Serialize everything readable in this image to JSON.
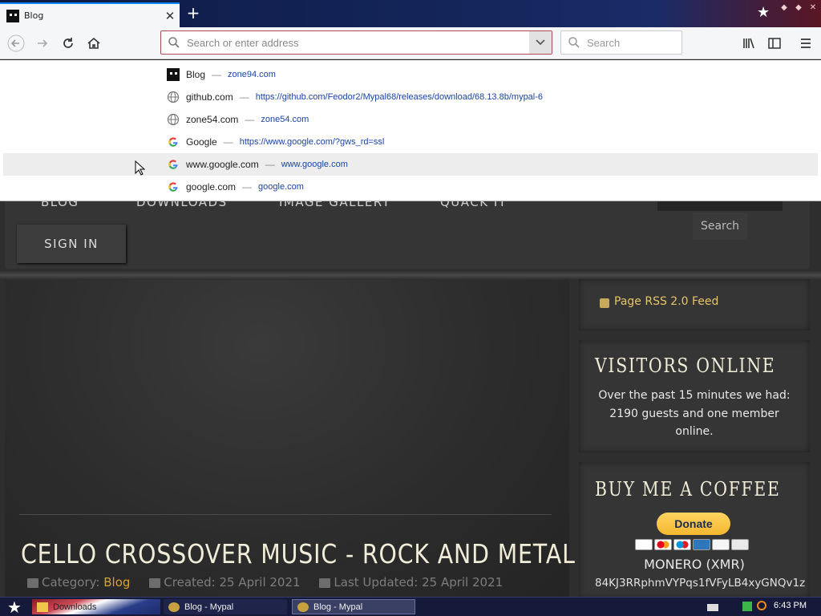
{
  "browser": {
    "tab": {
      "title": "Blog",
      "close_glyph": "✕"
    },
    "new_tab_glyph": "+",
    "url_bar": {
      "value": "",
      "placeholder": "Search or enter address"
    },
    "search_bar": {
      "placeholder": "Search"
    }
  },
  "suggestions": [
    {
      "icon": "site-favicon",
      "title": "Blog",
      "url": "zone94.com"
    },
    {
      "icon": "globe-icon",
      "title": "github.com",
      "url": "https://github.com/Feodor2/Mypal68/releases/download/68.13.8b/mypal-6"
    },
    {
      "icon": "globe-icon",
      "title": "zone54.com",
      "url": "zone54.com"
    },
    {
      "icon": "google-icon",
      "title": "Google",
      "url": "https://www.google.com/?gws_rd=ssl"
    },
    {
      "icon": "google-icon",
      "title": "www.google.com",
      "url": "www.google.com"
    },
    {
      "icon": "google-icon",
      "title": "google.com",
      "url": "google.com"
    }
  ],
  "site": {
    "nav": [
      "BLOG",
      "DOWNLOADS",
      "IMAGE GALLERY",
      "QUACK IT"
    ],
    "sign_in": "SIGN IN",
    "search_button": "Search",
    "article": {
      "title": "CELLO CROSSOVER MUSIC - ROCK AND METAL",
      "category_label": "Category:",
      "category": "Blog",
      "created": "Created: 25 April 2021",
      "updated": "Last Updated: 25 April 2021"
    },
    "rss": "Page RSS 2.0 Feed",
    "visitors": {
      "title": "VISITORS ONLINE",
      "text": "Over the past 15 minutes we had: 2190 guests and one member online."
    },
    "coffee": {
      "title": "BUY ME A COFFEE",
      "donate": "Donate",
      "monero_label": "MONERO (XMR)",
      "monero_address": "84KJ3RRphmVYPqs1fVFyLB4xyGNQv1z"
    }
  },
  "taskbar": {
    "tasks": [
      "Downloads",
      "Blog - Mypal",
      "Blog - Mypal"
    ],
    "clock": "6:43 PM"
  },
  "colors": {
    "accent_link": "#d9a22b",
    "rss_gold": "#e6c56a",
    "url_link": "#1a44a8"
  }
}
